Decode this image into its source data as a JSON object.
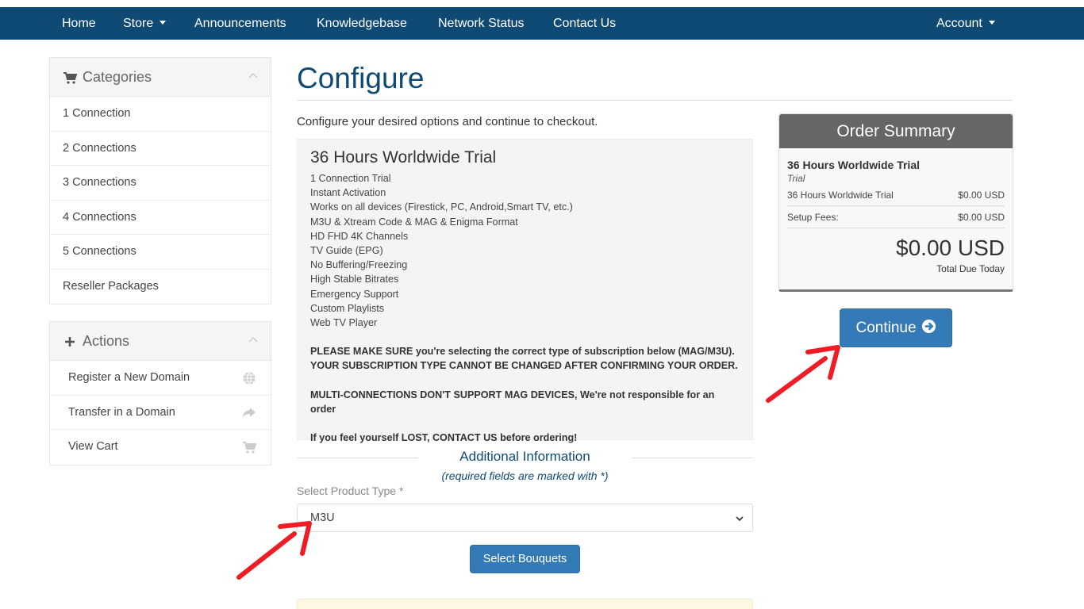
{
  "nav": {
    "home": "Home",
    "store": "Store",
    "announcements": "Announcements",
    "knowledgebase": "Knowledgebase",
    "network_status": "Network Status",
    "contact": "Contact Us",
    "account": "Account"
  },
  "categories": {
    "title": "Categories",
    "items": [
      "1 Connection",
      "2 Connections",
      "3 Connections",
      "4 Connections",
      "5 Connections",
      "Reseller Packages"
    ]
  },
  "actions": {
    "title": "Actions",
    "items": [
      {
        "label": "Register a New Domain",
        "icon": "globe-icon"
      },
      {
        "label": "Transfer in a Domain",
        "icon": "share-arrow-icon"
      },
      {
        "label": "View Cart",
        "icon": "cart-icon"
      }
    ]
  },
  "main": {
    "title": "Configure",
    "intro": "Configure your desired options and continue to checkout.",
    "product": {
      "name": "36 Hours Worldwide Trial",
      "features": [
        "1 Connection Trial",
        "Instant Activation",
        "Works on all devices (Firestick, PC, Android,Smart TV, etc.)",
        "M3U & Xtream Code & MAG & Enigma Format",
        "HD FHD 4K Channels",
        "TV Guide (EPG)",
        "No Buffering/Freezing",
        "High Stable Bitrates",
        "Emergency Support",
        "Custom Playlists",
        "Web TV Player"
      ],
      "notice1_line1": "PLEASE MAKE SURE you're selecting the correct type of subscription below (MAG/M3U).",
      "notice1_line2": "YOUR SUBSCRIPTION TYPE CANNOT BE CHANGED AFTER CONFIRMING YOUR ORDER.",
      "notice2": "MULTI-CONNECTIONS DON'T SUPPORT MAG DEVICES, We're not responsible for an order",
      "notice3": "If you feel yourself LOST, CONTACT US before ordering!"
    },
    "additional": {
      "title": "Additional Information",
      "subtitle": "(required fields are marked with *)",
      "field_label": "Select Product Type *",
      "field_value": "M3U",
      "button": "Select Bouquets"
    }
  },
  "summary": {
    "title": "Order Summary",
    "product": "36 Hours Worldwide Trial",
    "group": "Trial",
    "line1_label": "36 Hours Worldwide Trial",
    "line1_value": "$0.00 USD",
    "line2_label": "Setup Fees:",
    "line2_value": "$0.00 USD",
    "total": "$0.00 USD",
    "total_label": "Total Due Today",
    "continue": "Continue"
  },
  "colors": {
    "navbar": "#0f4a74",
    "primary_button": "#337ab7",
    "annotation_arrow": "#ee1c24"
  }
}
